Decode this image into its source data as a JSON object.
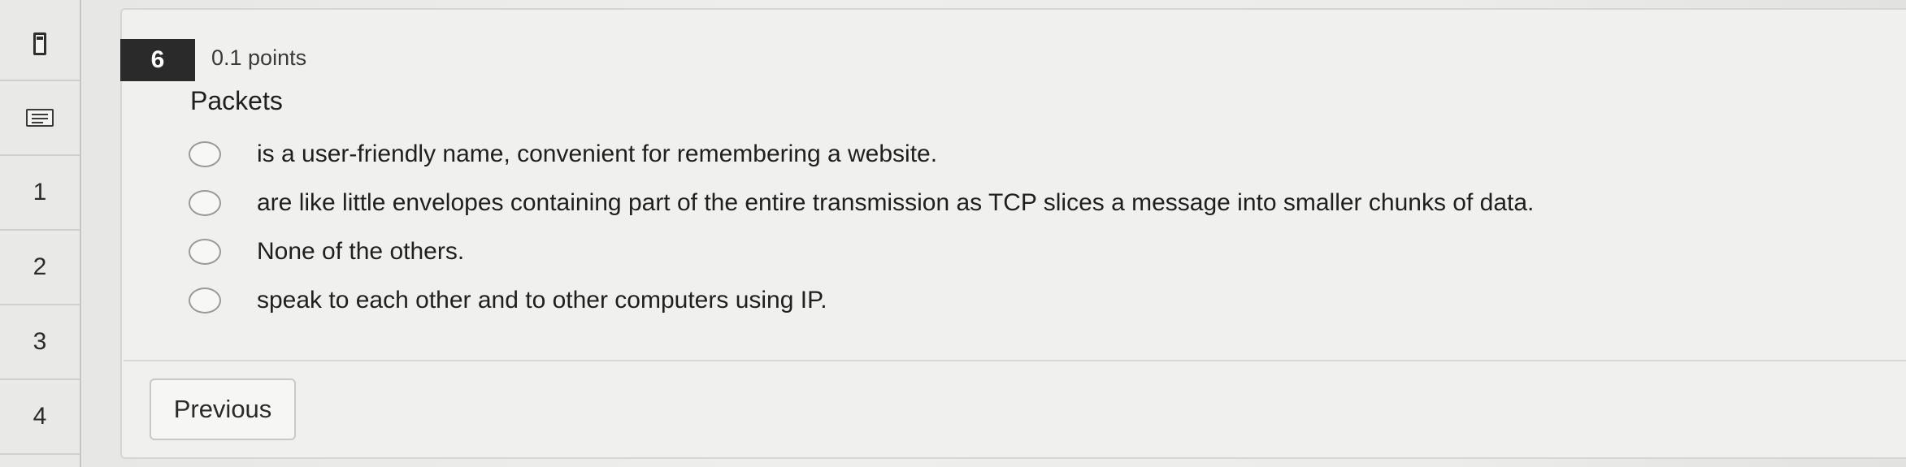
{
  "navigator": {
    "items": [
      {
        "icon": "bookmark-icon"
      },
      {
        "icon": "list-icon"
      },
      {
        "label": "1"
      },
      {
        "label": "2"
      },
      {
        "label": "3"
      },
      {
        "label": "4"
      }
    ]
  },
  "question": {
    "number": "6",
    "points": "0.1 points",
    "prompt": "Packets",
    "answers": [
      {
        "text": "is a user-friendly name, convenient for remembering a website.",
        "selected": false
      },
      {
        "text": "are like little envelopes containing part of the entire transmission as TCP slices a message into smaller chunks of data.",
        "selected": false
      },
      {
        "text": "None of the others.",
        "selected": false
      },
      {
        "text": "speak to each other and to other computers using IP.",
        "selected": false
      }
    ]
  },
  "footer": {
    "previous_label": "Previous"
  }
}
